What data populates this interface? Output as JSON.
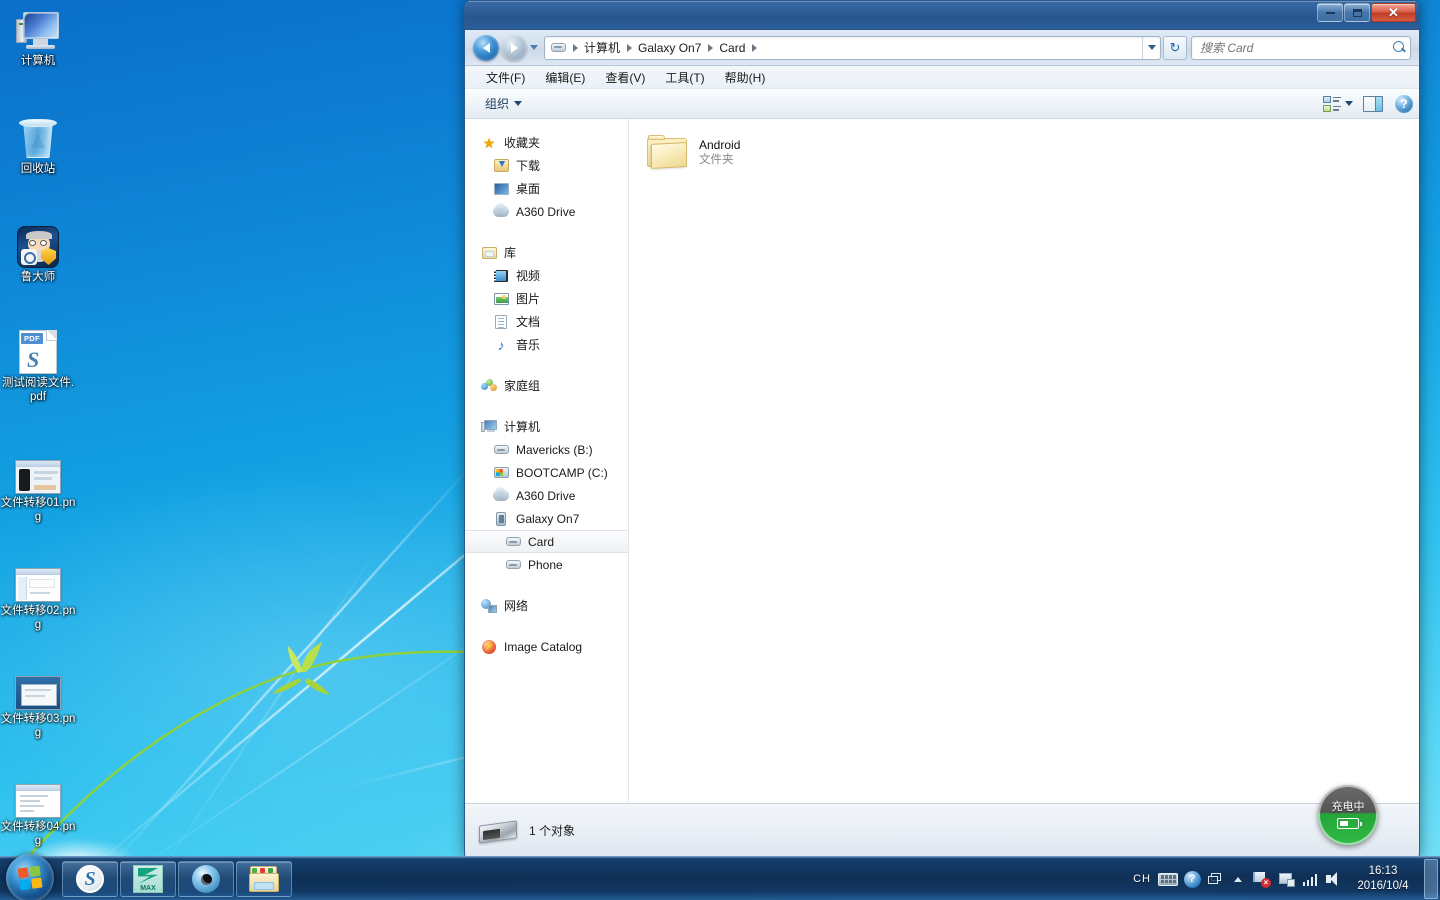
{
  "desktop": {
    "icons": [
      {
        "label": "计算机",
        "icon": "computer-icon"
      },
      {
        "label": "回收站",
        "icon": "recycle-bin-icon"
      },
      {
        "label": "鲁大师",
        "icon": "ludashi-app-icon"
      },
      {
        "label": "测试阅读文件.pdf",
        "icon": "pdf-file-icon"
      },
      {
        "label": "文件转移01.png",
        "icon": "png-image-icon"
      },
      {
        "label": "文件转移02.png",
        "icon": "png-image-icon"
      },
      {
        "label": "文件转移03.png",
        "icon": "png-image-icon"
      },
      {
        "label": "文件转移04.png",
        "icon": "png-image-icon"
      }
    ]
  },
  "window": {
    "controls": {
      "minimize": "–",
      "maximize": "□",
      "close": "✕"
    },
    "address": {
      "breadcrumbs": [
        "计算机",
        "Galaxy On7",
        "Card"
      ],
      "refresh_label": "↻"
    },
    "search": {
      "placeholder": "搜索 Card",
      "value": ""
    },
    "menubar": [
      "文件(F)",
      "编辑(E)",
      "查看(V)",
      "工具(T)",
      "帮助(H)"
    ],
    "toolbar": {
      "organize_label": "组织",
      "help_label": "?"
    }
  },
  "navpane": {
    "groups": [
      {
        "header": {
          "label": "收藏夹",
          "icon": "star-icon"
        },
        "items": [
          {
            "label": "下载",
            "icon": "downloads-icon"
          },
          {
            "label": "桌面",
            "icon": "desktop-icon"
          },
          {
            "label": "A360 Drive",
            "icon": "cloud-drive-icon"
          }
        ]
      },
      {
        "header": {
          "label": "库",
          "icon": "library-icon"
        },
        "items": [
          {
            "label": "视频",
            "icon": "video-icon"
          },
          {
            "label": "图片",
            "icon": "picture-icon"
          },
          {
            "label": "文档",
            "icon": "document-icon"
          },
          {
            "label": "音乐",
            "icon": "music-icon"
          }
        ]
      },
      {
        "header": {
          "label": "家庭组",
          "icon": "homegroup-icon"
        },
        "items": []
      },
      {
        "header": {
          "label": "计算机",
          "icon": "computer-icon"
        },
        "items": [
          {
            "label": "Mavericks (B:)",
            "icon": "drive-icon"
          },
          {
            "label": "BOOTCAMP (C:)",
            "icon": "windows-drive-icon"
          },
          {
            "label": "A360 Drive",
            "icon": "cloud-drive-icon"
          },
          {
            "label": "Galaxy On7",
            "icon": "phone-device-icon"
          },
          {
            "label": "Card",
            "icon": "removable-drive-icon",
            "selected": true,
            "indent": 2
          },
          {
            "label": "Phone",
            "icon": "removable-drive-icon",
            "indent": 2
          }
        ]
      },
      {
        "header": {
          "label": "网络",
          "icon": "network-icon"
        },
        "items": []
      },
      {
        "header": {
          "label": "Image Catalog",
          "icon": "image-catalog-icon"
        },
        "items": []
      }
    ]
  },
  "content": {
    "files": [
      {
        "name": "Android",
        "type": "文件夹",
        "icon": "folder-icon"
      }
    ]
  },
  "statusbar": {
    "text": "1 个对象",
    "icon": "removable-drive-icon"
  },
  "battery_widget": {
    "label": "充电中",
    "icon": "battery-charging-icon"
  },
  "taskbar": {
    "start_label": "开始",
    "apps": [
      {
        "name": "sogou-input",
        "icon": "sogou-icon"
      },
      {
        "name": "3ds-max",
        "icon": "max-icon",
        "badge": "MAX"
      },
      {
        "name": "media-player",
        "icon": "eye-icon"
      },
      {
        "name": "file-explorer",
        "icon": "folder-icon"
      }
    ],
    "tray": {
      "ime": "CH",
      "items": [
        "keyboard-icon",
        "help-icon",
        "window-icon",
        "overflow-arrow-icon",
        "action-center-flag-icon",
        "network-icon",
        "signal-bars-icon",
        "volume-icon"
      ],
      "clock_time": "16:13",
      "clock_date": "2016/10/4"
    }
  },
  "colors": {
    "titlebar": "#2e5c95",
    "accent": "#2a78c4",
    "close_button": "#c03d25",
    "battery_green": "#2fbb45",
    "desktop_top": "#0a6fc9",
    "desktop_bottom": "#79e2f8"
  }
}
